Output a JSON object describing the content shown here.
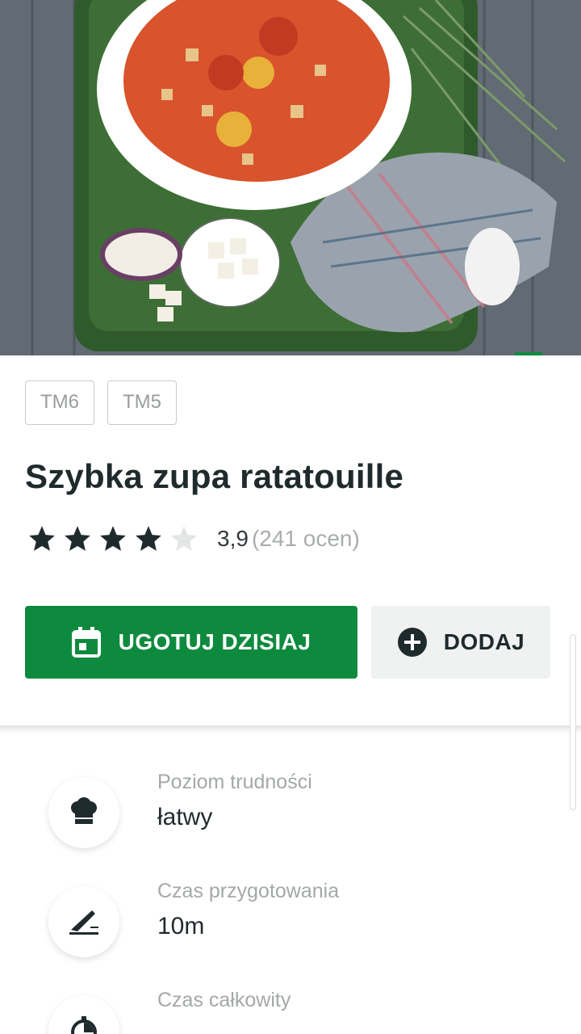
{
  "hero": {
    "image": "soup-bowl-photo"
  },
  "bookmark": {
    "icon": "bookmark-icon",
    "color": "#0e8a3e"
  },
  "chips": [
    "TM6",
    "TM5"
  ],
  "recipe": {
    "title": "Szybka zupa ratatouille",
    "rating_value": "3,9",
    "rating_count": "(241 ocen)",
    "stars": 3.9
  },
  "actions": {
    "cook_today": "UGOTUJ DZISIAJ",
    "add": "DODAJ"
  },
  "info": [
    {
      "icon": "chef-hat-icon",
      "label": "Poziom trudności",
      "value": "łatwy"
    },
    {
      "icon": "knife-icon",
      "label": "Czas przygotowania",
      "value": "10m"
    },
    {
      "icon": "timer-icon",
      "label": "Czas całkowity",
      "value": ""
    }
  ],
  "colors": {
    "accent": "#0e8a3e",
    "text": "#1f2a2c",
    "muted": "#a4a8a9"
  }
}
